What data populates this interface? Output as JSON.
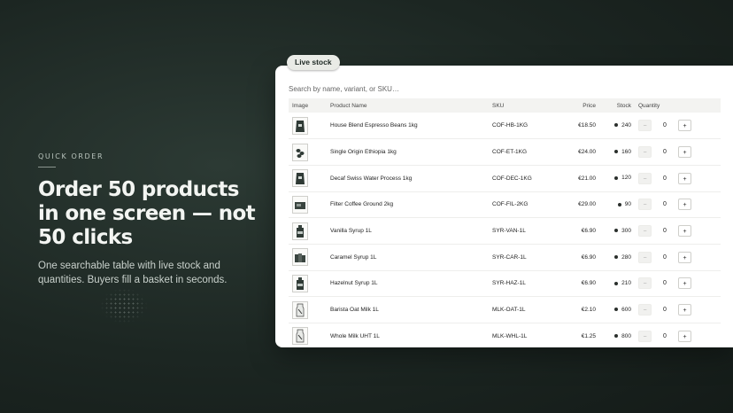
{
  "hero": {
    "eyebrow": "QUICK ORDER",
    "headline_line1": "Order 50 products",
    "headline_line2": "in one screen — not",
    "headline_line3": "50 clicks",
    "subtitle_line1": "One searchable table with live stock and",
    "subtitle_line2": "quantities. Buyers fill a basket in seconds."
  },
  "panel": {
    "badge": "Live stock",
    "search_placeholder": "Search by name, variant, or SKU…",
    "columns": {
      "image": "Image",
      "name": "Product Name",
      "sku": "SKU",
      "price": "Price",
      "stock": "Stock",
      "quantity": "Quantity"
    },
    "rows": [
      {
        "name": "House Blend Espresso Beans 1kg",
        "sku": "COF-HB-1KG",
        "price": "€18.50",
        "stock": "240",
        "qty": "0",
        "minus": "−",
        "plus": "+",
        "thumb": "coffee-bag-icon"
      },
      {
        "name": "Single Origin Ethiopia 1kg",
        "sku": "COF-ET-1KG",
        "price": "€24.00",
        "stock": "160",
        "qty": "0",
        "minus": "−",
        "plus": "+",
        "thumb": "coffee-beans-icon"
      },
      {
        "name": "Decaf Swiss Water Process 1kg",
        "sku": "COF-DEC-1KG",
        "price": "€21.00",
        "stock": "120",
        "qty": "0",
        "minus": "−",
        "plus": "+",
        "thumb": "coffee-bag-icon"
      },
      {
        "name": "Filter Coffee Ground 2kg",
        "sku": "COF-FIL-2KG",
        "price": "€29.00",
        "stock": "90",
        "qty": "0",
        "minus": "−",
        "plus": "+",
        "thumb": "ground-coffee-icon"
      },
      {
        "name": "Vanilla Syrup 1L",
        "sku": "SYR-VAN-1L",
        "price": "€6.90",
        "stock": "300",
        "qty": "0",
        "minus": "−",
        "plus": "+",
        "thumb": "syrup-bottle-icon"
      },
      {
        "name": "Caramel Syrup 1L",
        "sku": "SYR-CAR-1L",
        "price": "€6.90",
        "stock": "280",
        "qty": "0",
        "minus": "−",
        "plus": "+",
        "thumb": "syrup-bottles-icon"
      },
      {
        "name": "Hazelnut Syrup 1L",
        "sku": "SYR-HAZ-1L",
        "price": "€6.90",
        "stock": "210",
        "qty": "0",
        "minus": "−",
        "plus": "+",
        "thumb": "syrup-bottle-icon"
      },
      {
        "name": "Barista Oat Milk 1L",
        "sku": "MLK-OAT-1L",
        "price": "€2.10",
        "stock": "600",
        "qty": "0",
        "minus": "−",
        "plus": "+",
        "thumb": "milk-carton-icon"
      },
      {
        "name": "Whole Milk UHT 1L",
        "sku": "MLK-WHL-1L",
        "price": "€1.25",
        "stock": "800",
        "qty": "0",
        "minus": "−",
        "plus": "+",
        "thumb": "milk-carton-icon"
      }
    ]
  },
  "colors": {
    "background": "#1c2622",
    "panel": "#ffffff",
    "badge": "#e9ebe6",
    "stock_dot": "#2a2f2c"
  }
}
